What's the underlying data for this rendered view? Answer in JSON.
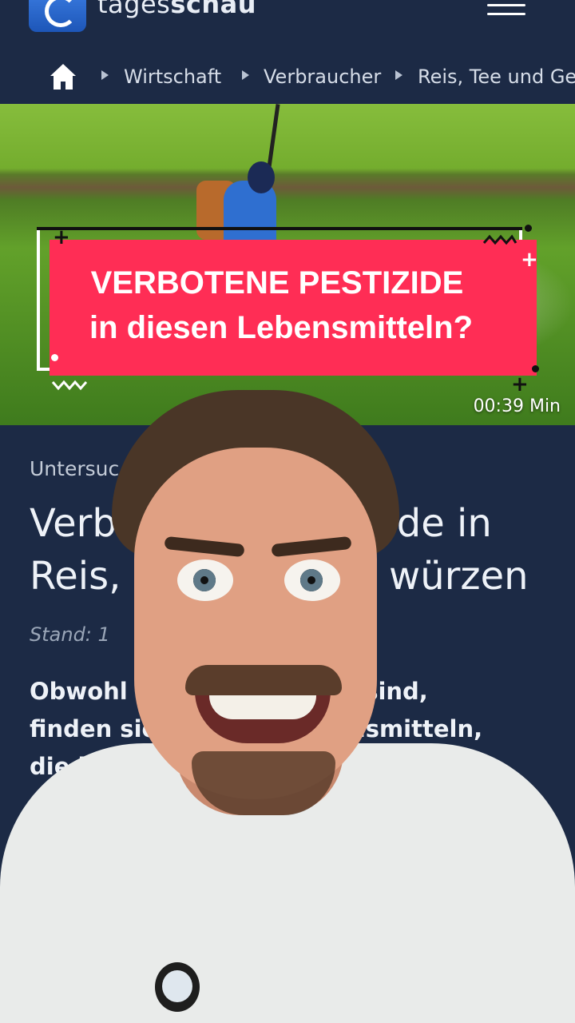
{
  "header": {
    "brand_light": "tages",
    "brand_bold": "schau"
  },
  "breadcrumb": {
    "items": [
      "Wirtschaft",
      "Verbraucher",
      "Reis, Tee und Gew"
    ]
  },
  "hero": {
    "duration": "00:39 Min"
  },
  "banner": {
    "line1": "VERBOTENE PESTIZIDE",
    "line2": "in diesen Lebensmitteln?"
  },
  "article": {
    "kicker": "Untersuc",
    "headline_line1": "Verb                       de in",
    "headline_line2": "Reis,                      würzen",
    "stand": "Stand: 1",
    "teaser_line1": "Obwohl                       ten sind,",
    "teaser_line2": "finden sic                    bensmitteln,",
    "teaser_line3": "die in E                        n. Das zeigt"
  },
  "colors": {
    "header_bg": "#1c2a45",
    "banner_red": "#ff2d55"
  }
}
